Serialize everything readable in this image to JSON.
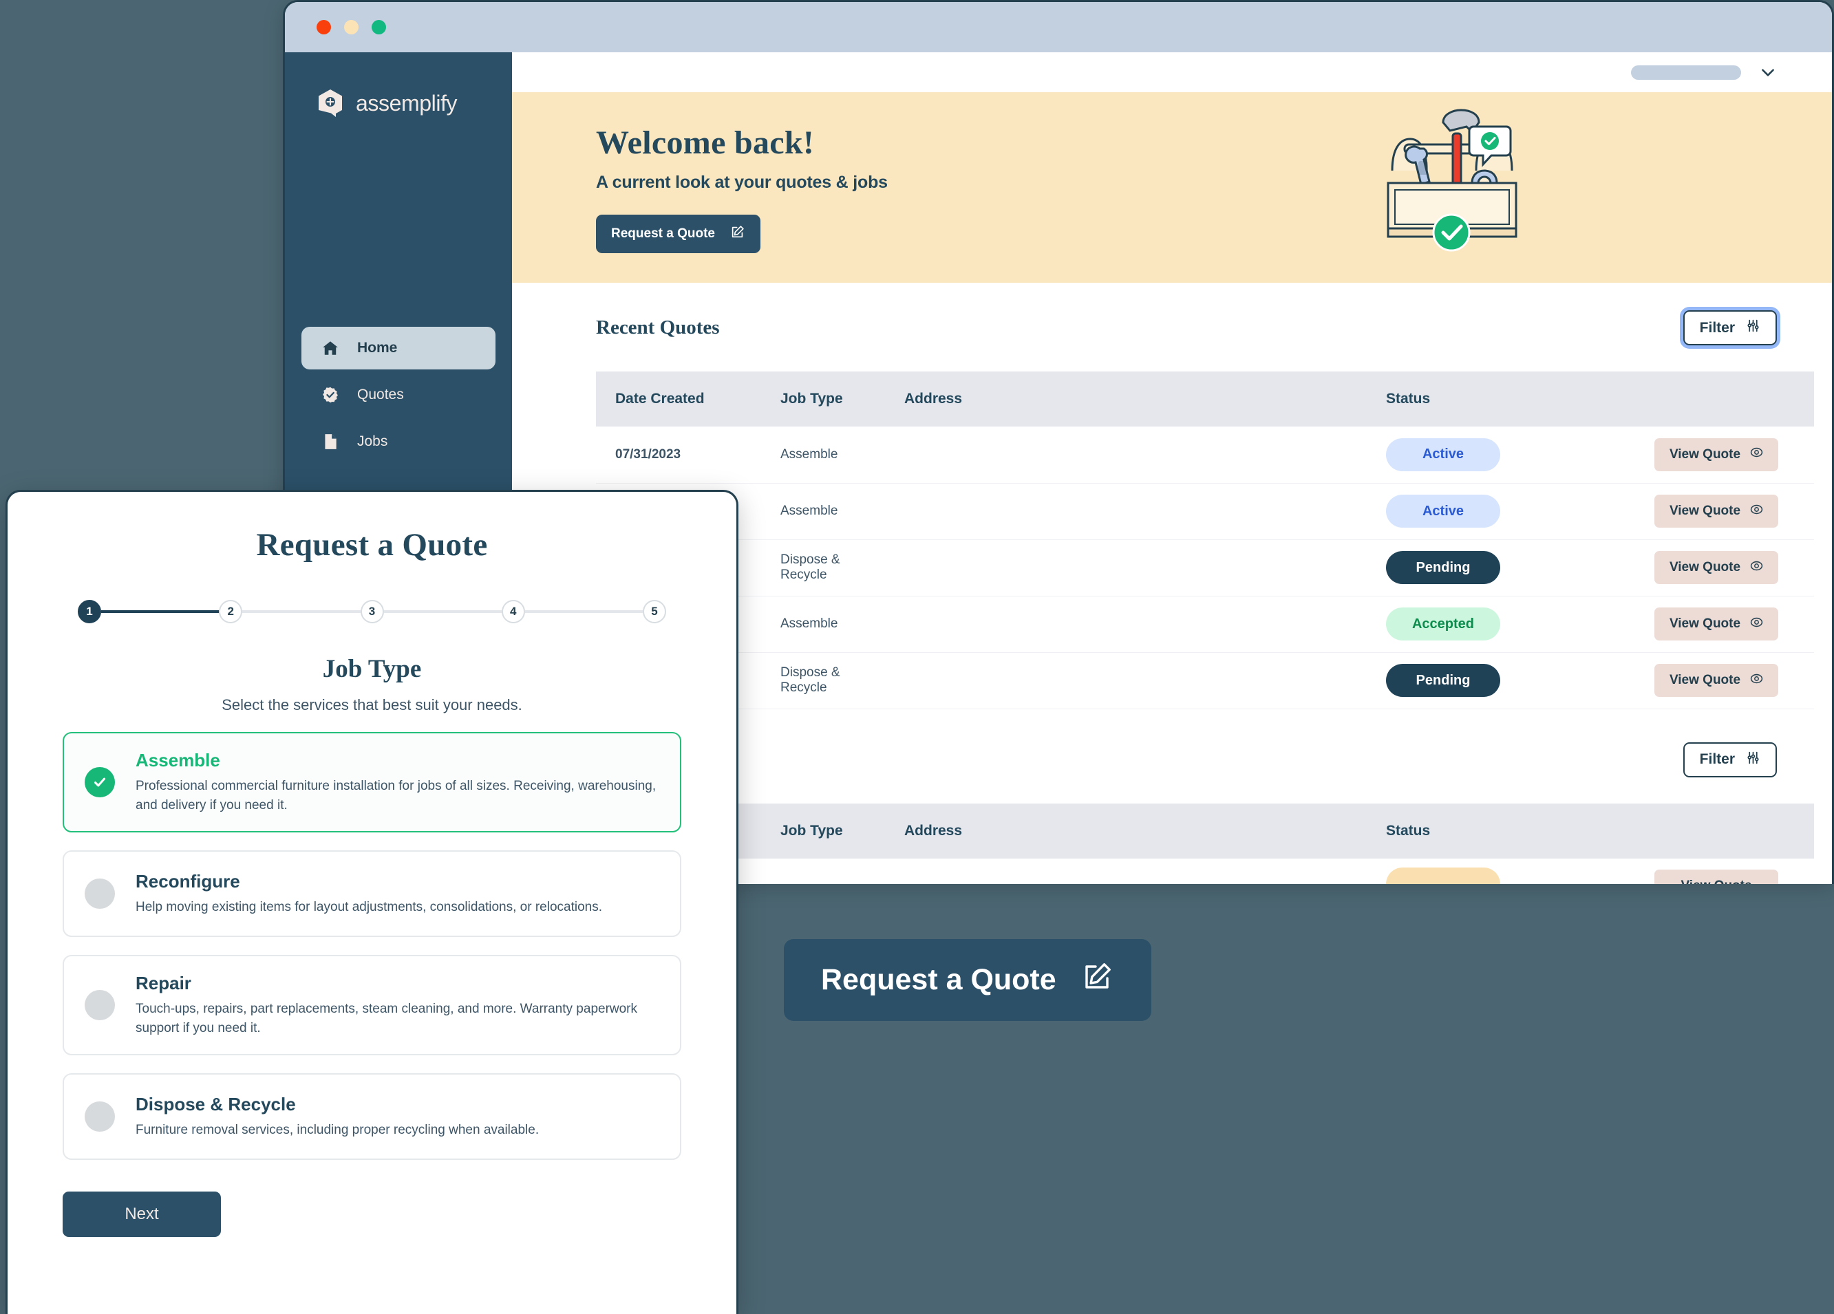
{
  "window": {
    "traffic_lights": [
      "close",
      "minimize",
      "maximize"
    ]
  },
  "sidebar": {
    "brand": "assemplify",
    "items": [
      {
        "label": "Home",
        "icon": "home-icon",
        "active": true
      },
      {
        "label": "Quotes",
        "icon": "badge-check-icon",
        "active": false
      },
      {
        "label": "Jobs",
        "icon": "document-icon",
        "active": false
      }
    ]
  },
  "topbar": {
    "account_chevron": "chevron-down-icon"
  },
  "banner": {
    "title": "Welcome back!",
    "subtitle": "A current look at your quotes & jobs",
    "cta_label": "Request a Quote",
    "cta_icon": "edit-square-icon",
    "illustration": "toolbox-illustration",
    "bg_color": "#fae7c0"
  },
  "recent_quotes": {
    "title": "Recent Quotes",
    "filter_label": "Filter",
    "filter_icon": "sliders-icon",
    "columns": [
      "Date Created",
      "Job Type",
      "Address",
      "Status",
      ""
    ],
    "rows": [
      {
        "date": "07/31/2023",
        "job_type": "Assemble",
        "address": "",
        "status": "Active",
        "status_kind": "active",
        "action": "View Quote"
      },
      {
        "date": "",
        "job_type": "Assemble",
        "address": "",
        "status": "Active",
        "status_kind": "active",
        "action": "View Quote"
      },
      {
        "date": "",
        "job_type": "Dispose & Recycle",
        "address": "",
        "status": "Pending",
        "status_kind": "pending",
        "action": "View Quote"
      },
      {
        "date": "",
        "job_type": "Assemble",
        "address": "",
        "status": "Accepted",
        "status_kind": "accepted",
        "action": "View Quote"
      },
      {
        "date": "",
        "job_type": "Dispose & Recycle",
        "address": "",
        "status": "Pending",
        "status_kind": "pending",
        "action": "View Quote"
      }
    ],
    "action_icon": "eye-icon"
  },
  "second_table": {
    "filter_label": "Filter",
    "filter_icon": "sliders-icon",
    "columns": [
      "Job Type",
      "Address",
      "Status",
      ""
    ],
    "rows": [
      {
        "job_type": "",
        "address": "",
        "status": "",
        "status_kind": "amberb",
        "action": "View Quote"
      }
    ]
  },
  "modal": {
    "title": "Request a Quote",
    "steps": [
      "1",
      "2",
      "3",
      "4",
      "5"
    ],
    "current_step": 1,
    "section_title": "Job Type",
    "lead": "Select the services that best suit your needs.",
    "options": [
      {
        "title": "Assemble",
        "description": "Professional commercial furniture installation for jobs of all sizes. Receiving, warehousing, and delivery if you need it.",
        "selected": true
      },
      {
        "title": "Reconfigure",
        "description": "Help moving existing items for layout adjustments, consolidations, or relocations.",
        "selected": false
      },
      {
        "title": "Repair",
        "description": "Touch-ups, repairs, part replacements, steam cleaning, and more. Warranty paperwork support if you need it.",
        "selected": false
      },
      {
        "title": "Dispose & Recycle",
        "description": "Furniture removal services, including proper recycling when available.",
        "selected": false
      }
    ],
    "next_label": "Next"
  },
  "cta": {
    "label": "Request a Quote",
    "icon": "edit-square-icon"
  },
  "colors": {
    "page_bg": "#4b6672",
    "brand_navy": "#2b5068",
    "banner_bg": "#fae7c0",
    "accent_green": "#17b877",
    "badge_active_bg": "#d6e4fd",
    "badge_accepted_bg": "#ccf7de",
    "view_quote_bg": "#eddcd6"
  }
}
